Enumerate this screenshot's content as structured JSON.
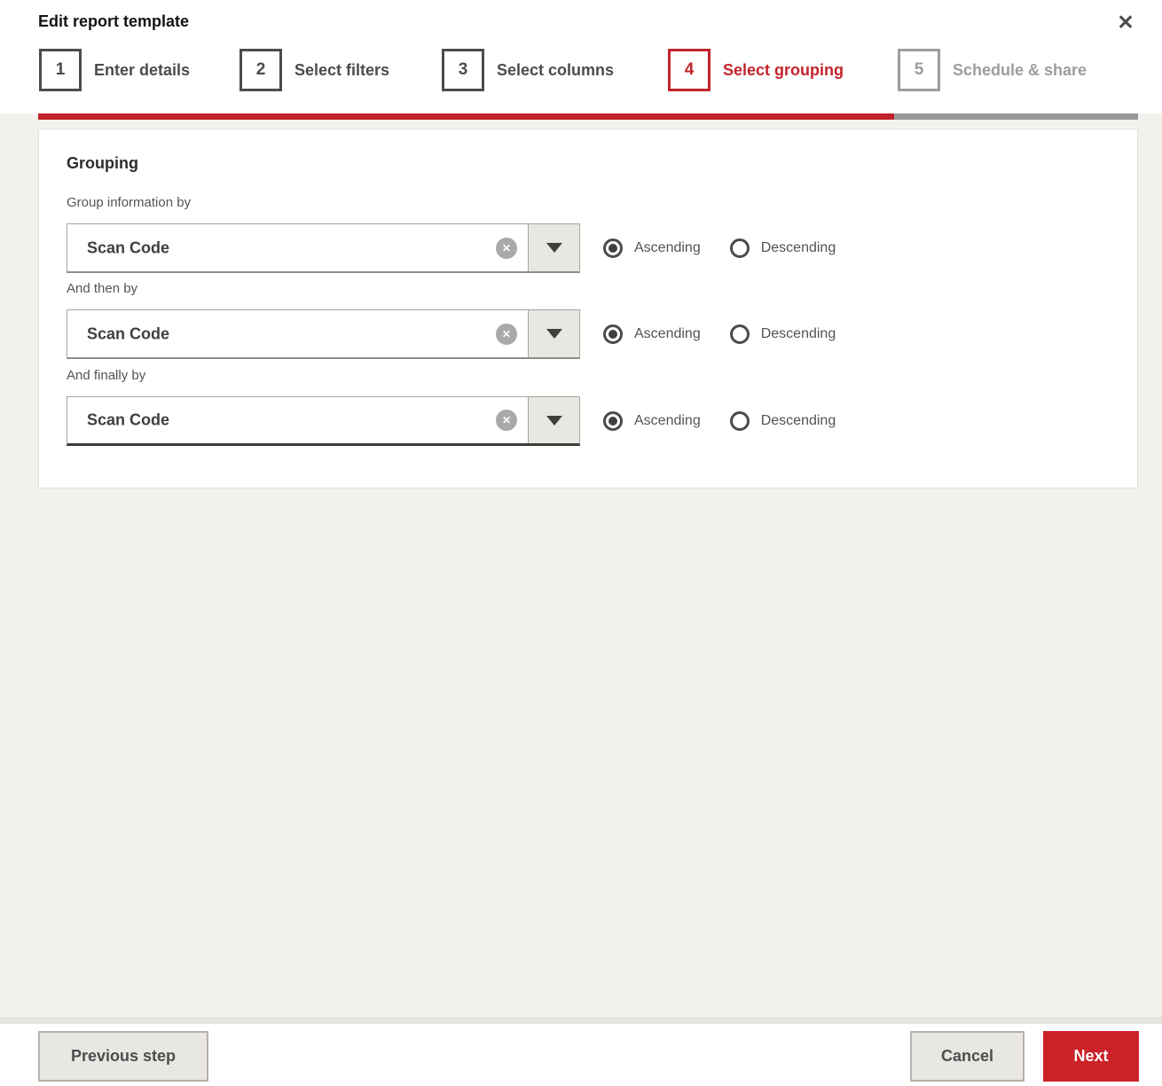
{
  "dialog": {
    "title": "Edit report template"
  },
  "icons": {
    "close": "✕",
    "clear": "✕"
  },
  "steps": [
    {
      "number": "1",
      "label": "Enter details",
      "state": "complete"
    },
    {
      "number": "2",
      "label": "Select filters",
      "state": "complete"
    },
    {
      "number": "3",
      "label": "Select columns",
      "state": "complete"
    },
    {
      "number": "4",
      "label": "Select grouping",
      "state": "active"
    },
    {
      "number": "5",
      "label": "Schedule & share",
      "state": "upcoming"
    }
  ],
  "progress": {
    "completed_steps": 4,
    "total_steps": 5,
    "fill_style": "width:77.8%"
  },
  "grouping": {
    "heading": "Grouping",
    "sort_options": [
      "Ascending",
      "Descending"
    ],
    "rows": [
      {
        "label": "Group information by",
        "value": "Scan Code",
        "sort": "Ascending"
      },
      {
        "label": "And then by",
        "value": "Scan Code",
        "sort": "Ascending"
      },
      {
        "label": "And finally by",
        "value": "Scan Code",
        "sort": "Ascending"
      }
    ]
  },
  "footer": {
    "previous": "Previous step",
    "cancel": "Cancel",
    "next": "Next"
  },
  "colors": {
    "accent_red": "#c3242b",
    "progress_red": "#c2232a",
    "progress_gray": "#98999a",
    "step_dark": "#4c4c4e",
    "step_disabled": "#9d9d9d",
    "page_background": "#f2f1ee"
  }
}
